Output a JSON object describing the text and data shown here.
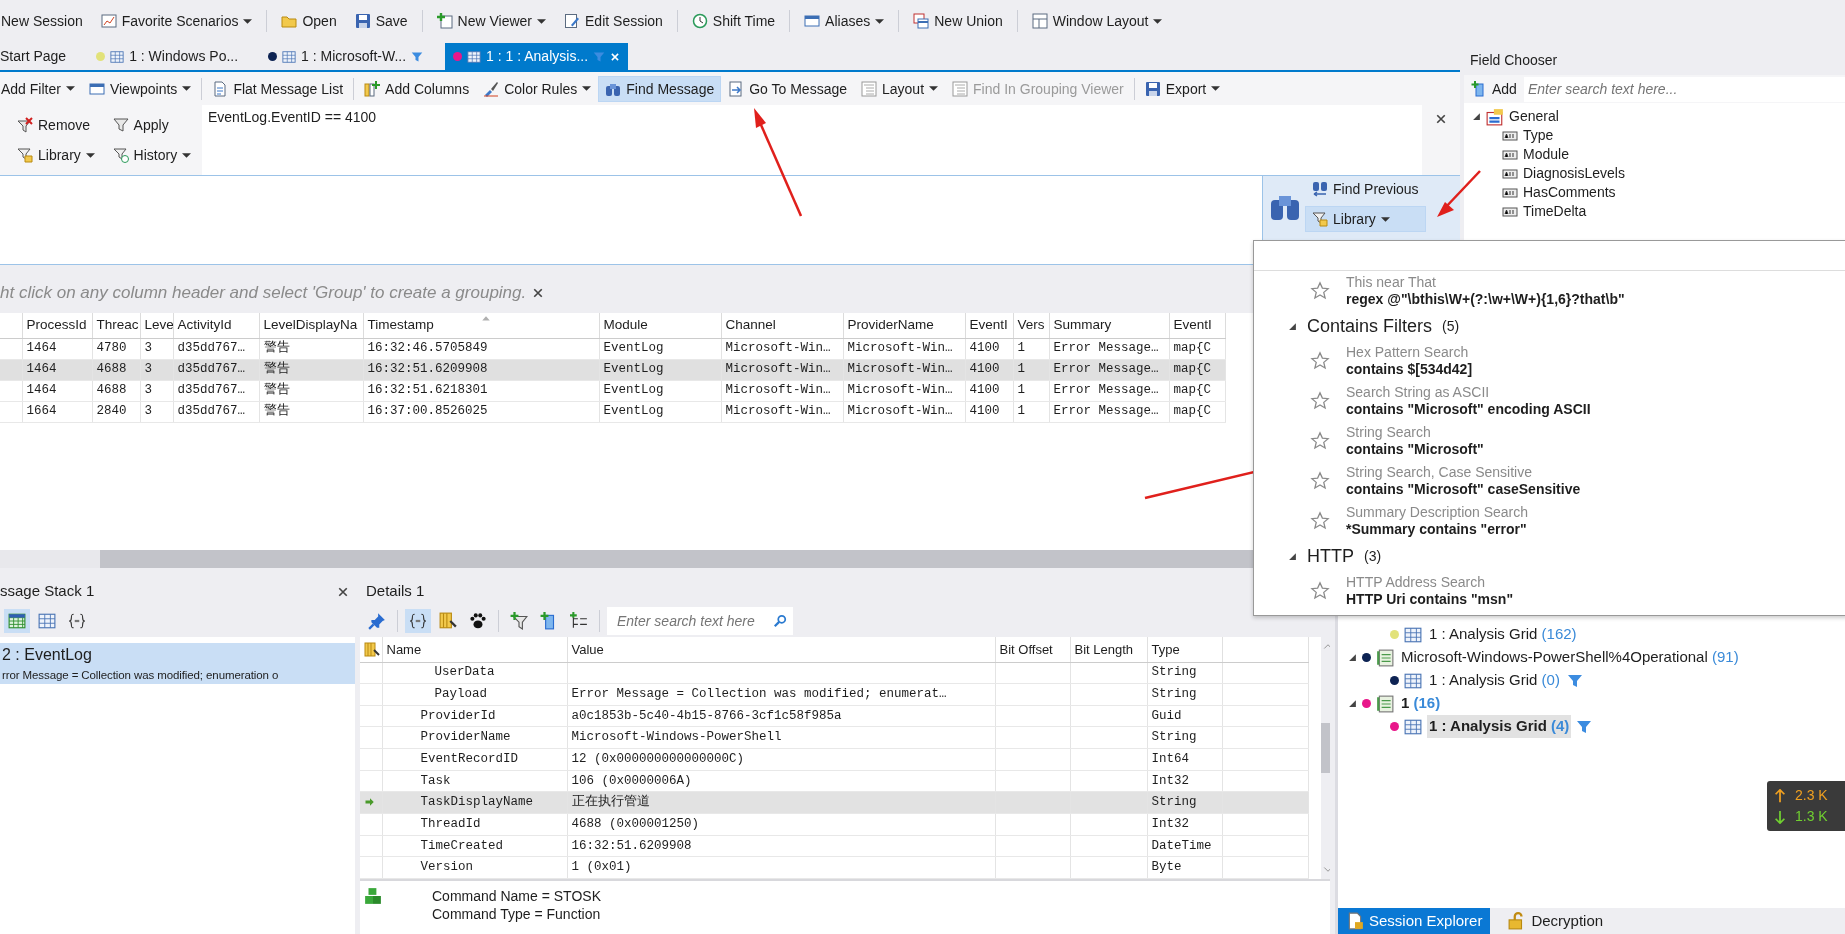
{
  "main_toolbar": [
    {
      "label": "New Session",
      "dropdown": false
    },
    {
      "label": "Favorite Scenarios",
      "dropdown": true
    },
    {
      "label": "Open",
      "dropdown": false
    },
    {
      "label": "Save",
      "dropdown": false
    },
    {
      "label": "New Viewer",
      "dropdown": true
    },
    {
      "label": "Edit Session",
      "dropdown": false
    },
    {
      "label": "Shift Time",
      "dropdown": false
    },
    {
      "label": "Aliases",
      "dropdown": true
    },
    {
      "label": "New Union",
      "dropdown": false
    },
    {
      "label": "Window Layout",
      "dropdown": true
    }
  ],
  "tabs": [
    {
      "label": "Start Page",
      "selected": false,
      "filtered": false
    },
    {
      "label": "1 : Windows Po...",
      "selected": false,
      "color": "#e2e27a",
      "filtered": false
    },
    {
      "label": "1 : Microsoft-W...",
      "selected": false,
      "color": "#0d2353",
      "filtered": true
    },
    {
      "label": "1 : 1 : Analysis...",
      "selected": true,
      "color": "#e8178a",
      "filtered": true
    }
  ],
  "viewer_toolbar": [
    {
      "label": "Add Filter",
      "dropdown": true,
      "active": false,
      "disabled": false
    },
    {
      "label": "Viewpoints",
      "dropdown": true,
      "active": false,
      "disabled": false
    },
    {
      "label": "Flat Message List",
      "dropdown": false,
      "active": false,
      "disabled": false
    },
    {
      "label": "Add Columns",
      "dropdown": false,
      "active": false,
      "disabled": false
    },
    {
      "label": "Color Rules",
      "dropdown": true,
      "active": false,
      "disabled": false
    },
    {
      "label": "Find Message",
      "dropdown": false,
      "active": true,
      "disabled": false
    },
    {
      "label": "Go To Message",
      "dropdown": false,
      "active": false,
      "disabled": false
    },
    {
      "label": "Layout",
      "dropdown": true,
      "active": false,
      "disabled": false
    },
    {
      "label": "Find In Grouping Viewer",
      "dropdown": false,
      "active": false,
      "disabled": true
    },
    {
      "label": "Export",
      "dropdown": true,
      "active": false,
      "disabled": false
    }
  ],
  "filter_bar": {
    "buttons": [
      {
        "label": "Remove",
        "dropdown": false
      },
      {
        "label": "Apply",
        "dropdown": false
      },
      {
        "label": "Library",
        "dropdown": true
      },
      {
        "label": "History",
        "dropdown": true
      }
    ],
    "expression": "EventLog.EventID == 4100"
  },
  "find_panel": {
    "buttons": [
      {
        "label": "Find Previous",
        "dropdown": false,
        "active": false
      },
      {
        "label": "Library",
        "dropdown": true,
        "active": true
      }
    ]
  },
  "group_hint": "ht click on any column header and select 'Group' to create a grouping.",
  "grid": {
    "columns": [
      {
        "label": "ProcessId",
        "sorted": false
      },
      {
        "label": "Threac",
        "sorted": false
      },
      {
        "label": "Leve",
        "sorted": false
      },
      {
        "label": "ActivityId",
        "sorted": false
      },
      {
        "label": "LevelDisplayNa",
        "sorted": false
      },
      {
        "label": "Timestamp",
        "sorted": true
      },
      {
        "label": "Module",
        "sorted": false
      },
      {
        "label": "Channel",
        "sorted": false
      },
      {
        "label": "ProviderName",
        "sorted": false
      },
      {
        "label": "EventI",
        "sorted": false
      },
      {
        "label": "Vers",
        "sorted": false
      },
      {
        "label": "Summary",
        "sorted": false
      },
      {
        "label": "EventI",
        "sorted": false
      }
    ],
    "rows": [
      {
        "selected": false,
        "cells": [
          "1464",
          "4780",
          "3",
          "d35dd767…",
          "警告",
          "16:32:46.5705849",
          "EventLog",
          "Microsoft-Win…",
          "Microsoft-Win…",
          "4100",
          "1",
          "Error Message…",
          "map{C"
        ]
      },
      {
        "selected": true,
        "cells": [
          "1464",
          "4688",
          "3",
          "d35dd767…",
          "警告",
          "16:32:51.6209908",
          "EventLog",
          "Microsoft-Win…",
          "Microsoft-Win…",
          "4100",
          "1",
          "Error Message…",
          "map{C"
        ]
      },
      {
        "selected": false,
        "cells": [
          "1464",
          "4688",
          "3",
          "d35dd767…",
          "警告",
          "16:32:51.6218301",
          "EventLog",
          "Microsoft-Win…",
          "Microsoft-Win…",
          "4100",
          "1",
          "Error Message…",
          "map{C"
        ]
      },
      {
        "selected": false,
        "cells": [
          "1664",
          "2840",
          "3",
          "d35dd767…",
          "警告",
          "16:37:00.8526025",
          "EventLog",
          "Microsoft-Win…",
          "Microsoft-Win…",
          "4100",
          "1",
          "Error Message…",
          "map{C"
        ]
      }
    ]
  },
  "field_chooser": {
    "title": "Field Chooser",
    "add_label": "Add",
    "search_placeholder": "Enter search text here...",
    "tree": [
      {
        "label": "General",
        "expanded": true,
        "children": [
          {
            "label": "Type"
          },
          {
            "label": "Module"
          },
          {
            "label": "DiagnosisLevels"
          },
          {
            "label": "HasComments"
          },
          {
            "label": "TimeDelta"
          }
        ]
      }
    ]
  },
  "library_popup": {
    "sections": [
      {
        "items": [
          {
            "title": "This near That",
            "expression": "regex @\"\\bthis\\W+(?:\\w+\\W+){1,6}?that\\b\""
          }
        ]
      },
      {
        "name": "Contains Filters",
        "count": "(5)",
        "expanded": true,
        "items": [
          {
            "title": "Hex Pattern Search",
            "expression": "contains $[534d42]"
          },
          {
            "title": "Search String as ASCII",
            "expression": "contains \"Microsoft\" encoding ASCII"
          },
          {
            "title": "String Search",
            "expression": "contains \"Microsoft\""
          },
          {
            "title": "String Search, Case Sensitive",
            "expression": "contains \"Microsoft\" caseSensitive"
          },
          {
            "title": "Summary Description Search",
            "expression": "*Summary contains \"error\""
          }
        ]
      },
      {
        "name": "HTTP",
        "count": "(3)",
        "expanded": true,
        "items": [
          {
            "title": "HTTP Address Search",
            "expression": "HTTP Uri contains \"msn\""
          }
        ]
      }
    ]
  },
  "message_stack": {
    "title": "ssage Stack 1",
    "tools": [
      {
        "selected": true
      },
      {
        "selected": false
      },
      {
        "selected": false
      }
    ],
    "entries": [
      {
        "title": "2 : EventLog",
        "summary": "rror Message = Collection was modified; enumeration o",
        "selected": true
      }
    ]
  },
  "details": {
    "title": "Details 1",
    "tools": [
      {
        "selected": false
      },
      {
        "selected": true
      },
      {
        "selected": false
      },
      {
        "selected": false
      },
      {
        "selected": false
      },
      {
        "selected": false
      },
      {
        "selected": false
      }
    ],
    "search_placeholder": "Enter search text here",
    "columns": [
      "Name",
      "Value",
      "Bit Offset",
      "Bit Length",
      "Type"
    ],
    "rows": [
      {
        "kind": "subfield",
        "name": "UserData",
        "type": "String",
        "selected": false
      },
      {
        "kind": "subfield",
        "name": "Payload",
        "value": "Error Message = Collection was modified; enumerat…",
        "type": "String",
        "selected": false
      },
      {
        "kind": "field",
        "name": "ProviderId",
        "value": "a0c1853b-5c40-4b15-8766-3cf1c58f985a",
        "type": "Guid",
        "selected": false
      },
      {
        "kind": "field",
        "name": "ProviderName",
        "value": "Microsoft-Windows-PowerShell",
        "type": "String",
        "selected": false
      },
      {
        "kind": "field",
        "name": "EventRecordID",
        "value": "12 (0x000000000000000C)",
        "type": "Int64",
        "selected": false
      },
      {
        "kind": "field",
        "name": "Task",
        "value": "106 (0x0000006A)",
        "type": "Int32",
        "selected": false
      },
      {
        "kind": "field",
        "name": "TaskDisplayName",
        "value": "正在执行管道",
        "type": "String",
        "selected": true
      },
      {
        "kind": "field",
        "name": "ThreadId",
        "value": "4688 (0x00001250)",
        "type": "Int32",
        "selected": false
      },
      {
        "kind": "field",
        "name": "TimeCreated",
        "value": "16:32:51.6209908",
        "type": "DateTime",
        "selected": false
      },
      {
        "kind": "field",
        "name": "Version",
        "value": "1 (0x01)",
        "type": "Byte",
        "selected": false
      }
    ],
    "raw_lines": [
      "Command Name = STOSK",
      "Command Type = Function"
    ]
  },
  "session_explorer": {
    "tree": [
      {
        "expanded": true,
        "children": [
          {
            "label": "1 : Analysis Grid",
            "count": "(162)",
            "color": "#e2e27a",
            "filtered": false,
            "active": false,
            "selected": false
          }
        ]
      },
      {
        "label": "Microsoft-Windows-PowerShell%4Operational",
        "count": "(91)",
        "color": "#0d2353",
        "expanded": true,
        "active": false,
        "children": [
          {
            "label": "1 : Analysis Grid",
            "count": "(0)",
            "color": "#0d2353",
            "filtered": true,
            "active": false,
            "selected": false
          }
        ]
      },
      {
        "label": "1",
        "count": "(16)",
        "color": "#e8178a",
        "expanded": true,
        "active": true,
        "children": [
          {
            "label": "1 : Analysis Grid",
            "count": "(4)",
            "color": "#e8178a",
            "filtered": true,
            "active": true,
            "selected": true
          }
        ]
      }
    ],
    "tabs": [
      {
        "label": "Session Explorer",
        "selected": true
      },
      {
        "label": "Decryption",
        "selected": false
      }
    ]
  },
  "traffic": {
    "up": "2.3 K",
    "down": "1.3 K"
  }
}
